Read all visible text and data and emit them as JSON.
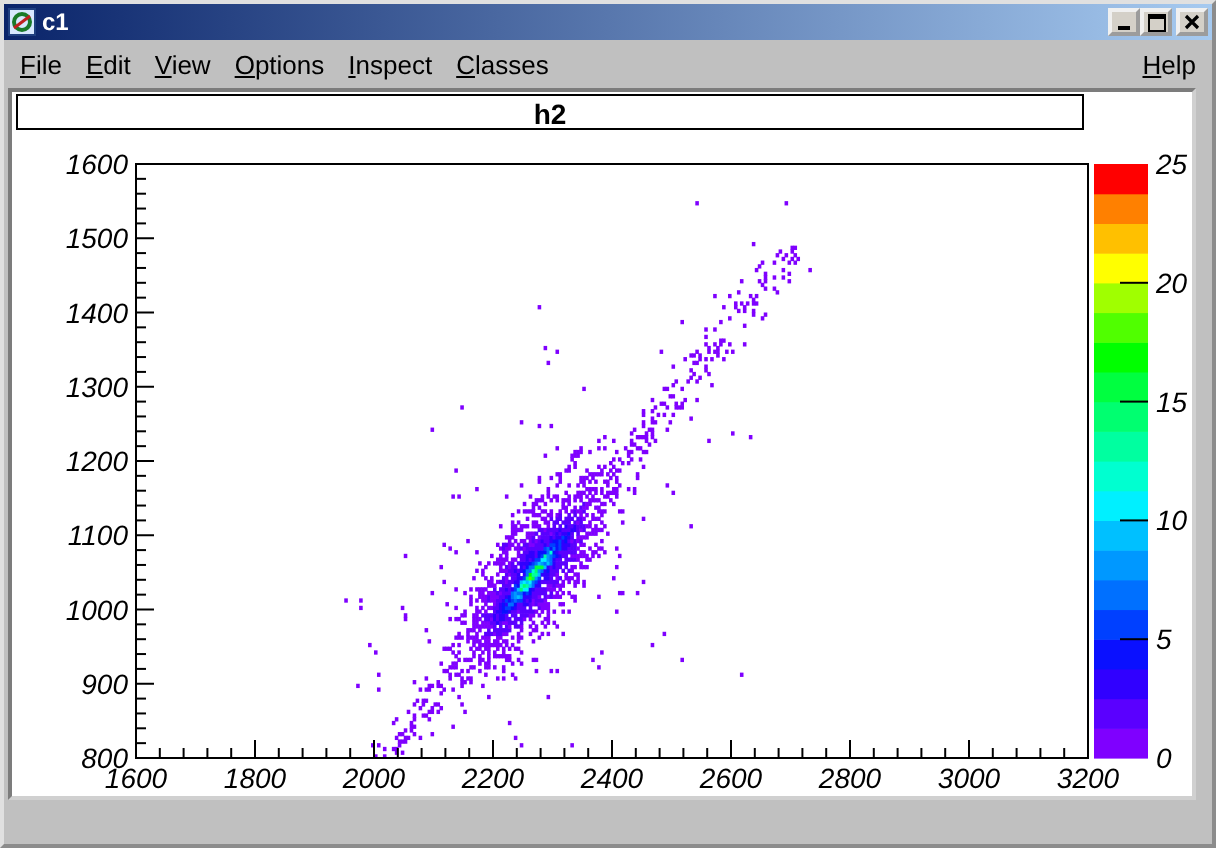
{
  "window": {
    "title": "c1"
  },
  "menu": [
    {
      "label": "File"
    },
    {
      "label": "Edit"
    },
    {
      "label": "View"
    },
    {
      "label": "Options"
    },
    {
      "label": "Inspect"
    },
    {
      "label": "Classes"
    },
    {
      "label": "Help"
    }
  ],
  "canvas": {
    "title": "h2",
    "x_axis": {
      "labels": [
        "1600",
        "1800",
        "2000",
        "2200",
        "2400",
        "2600",
        "2800",
        "3000",
        "3200"
      ]
    },
    "y_axis": {
      "labels": [
        "1600",
        "1500",
        "1400",
        "1300",
        "1200",
        "1100",
        "1000",
        "900",
        "800"
      ]
    },
    "color_scale": {
      "labels": [
        "25",
        "20",
        "15",
        "10",
        "5",
        "0"
      ]
    }
  }
}
